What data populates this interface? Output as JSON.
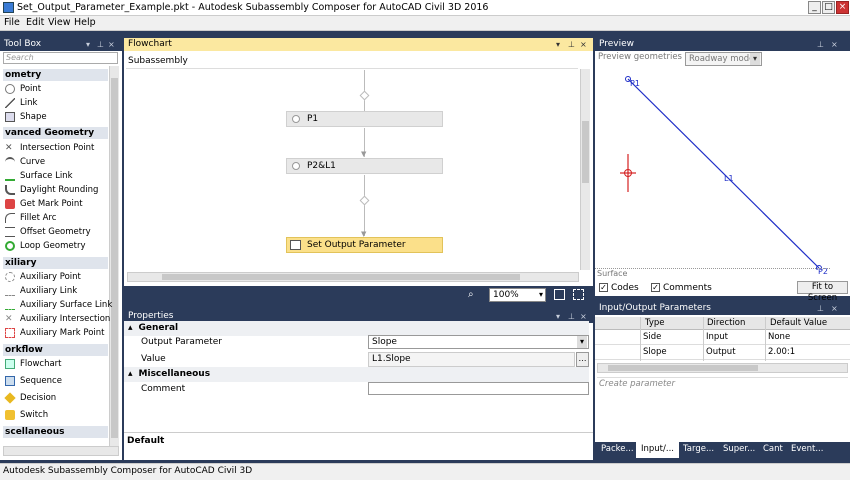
{
  "window": {
    "title": "Set_Output_Parameter_Example.pkt - Autodesk Subassembly Composer for AutoCAD Civil 3D 2016",
    "minimize": "_",
    "restore": "□",
    "close": "×"
  },
  "menu": [
    "File",
    "Edit",
    "View",
    "Help"
  ],
  "toolbox": {
    "title": "Tool Box",
    "search_placeholder": "Search",
    "cat_geometry": "ometry",
    "geometry_items": [
      "Point",
      "Link",
      "Shape"
    ],
    "cat_advanced": "vanced Geometry",
    "advanced_items": [
      "Intersection Point",
      "Curve",
      "Surface Link",
      "Daylight Rounding",
      "Get Mark Point",
      "Fillet Arc",
      "Offset Geometry",
      "Loop Geometry"
    ],
    "cat_auxiliary": "xiliary",
    "auxiliary_items": [
      "Auxiliary Point",
      "Auxiliary Link",
      "Auxiliary Surface Link",
      "Auxiliary Intersection",
      "Auxiliary Mark Point"
    ],
    "cat_workflow": "orkflow",
    "workflow_items": [
      "Flowchart",
      "Sequence",
      "Decision",
      "Switch"
    ],
    "cat_misc": "scellaneous"
  },
  "flowchart": {
    "title": "Flowchart",
    "breadcrumb": "Subassembly",
    "nodes": [
      "P1",
      "P2&L1",
      "Set Output Parameter"
    ],
    "zoom": "100%"
  },
  "preview": {
    "title": "Preview",
    "geometries_label": "Preview geometries in",
    "mode": "Roadway mode",
    "point1": "P1",
    "point2": "P2",
    "link": "L1",
    "surface": "Surface",
    "codes": "Codes",
    "comments": "Comments",
    "fit": "Fit to Screen"
  },
  "properties": {
    "title": "Properties",
    "group_general": "General",
    "output_param_label": "Output Parameter",
    "output_param_value": "Slope",
    "value_label": "Value",
    "value_value": "L1.Slope",
    "group_misc": "Miscellaneous",
    "comment_label": "Comment",
    "comment_value": "",
    "description": "Default"
  },
  "io_params": {
    "title": "Input/Output Parameters",
    "columns": [
      "Type",
      "Direction",
      "Default Value"
    ],
    "rows": [
      {
        "type": "Side",
        "direction": "Input",
        "default": "None"
      },
      {
        "type": "Slope",
        "direction": "Output",
        "default": "2.00:1"
      }
    ],
    "create": "Create parameter"
  },
  "bottom_tabs": [
    "Packe...",
    "Input/...",
    "Targe...",
    "Super...",
    "Cant",
    "Event..."
  ],
  "status": "Autodesk Subassembly Composer for AutoCAD Civil 3D",
  "colors": {
    "accent": "#2b3b5a",
    "selected": "#fbe08a",
    "preview_line": "#1f2ec8",
    "origin": "#d42020"
  }
}
